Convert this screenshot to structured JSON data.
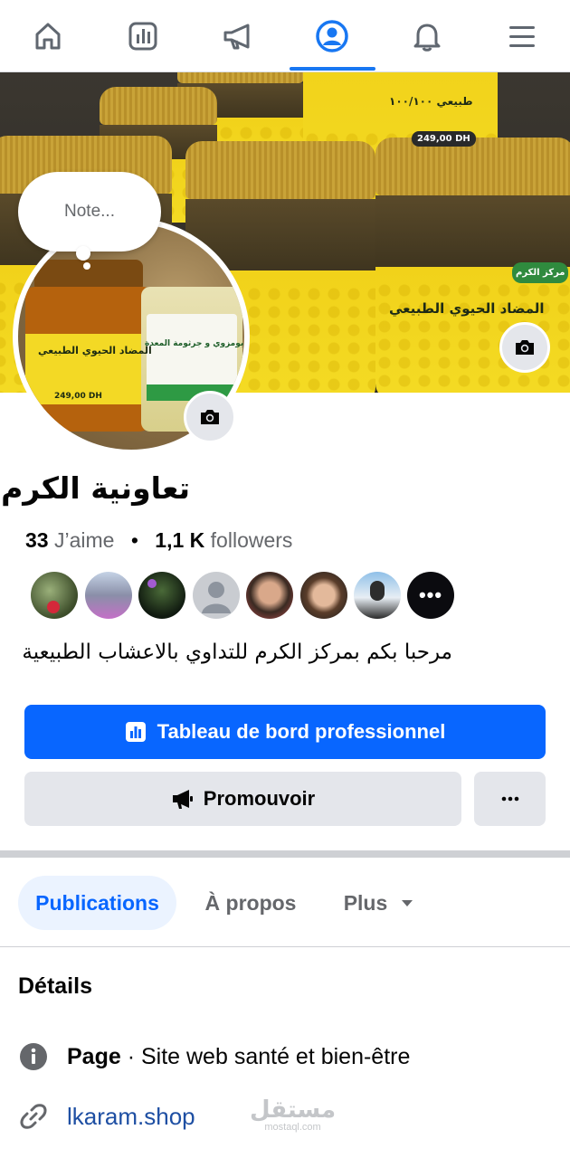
{
  "nav": {
    "items": [
      {
        "name": "home",
        "icon": "home-icon"
      },
      {
        "name": "dashboard",
        "icon": "bar-chart-icon"
      },
      {
        "name": "ads",
        "icon": "megaphone-icon"
      },
      {
        "name": "profile",
        "icon": "profile-icon",
        "active": true
      },
      {
        "name": "notifications",
        "icon": "bell-icon"
      },
      {
        "name": "menu",
        "icon": "hamburger-menu-icon"
      }
    ],
    "accent": "#1877f2"
  },
  "note": {
    "placeholder": "Note..."
  },
  "page": {
    "name": "تعاونية الكرم",
    "likes_count": "33",
    "likes_label": "J’aime",
    "followers_count": "1,1 K",
    "followers_label": "followers",
    "more_followers_label": "•••",
    "bio": "مرحبا بكم بمركز الكرم للتداوي بالاعشاب الطبيعية"
  },
  "cover_labels": {
    "product_name": "المضاد الحيوي الطبيعي",
    "brand": "مركز الكرم",
    "price": "249,00 DH",
    "natural": "طبيعي ١٠٠/١٠٠",
    "product2": "تركيبة بومزوي و جرثومة المعدة"
  },
  "actions": {
    "dashboard_label": "Tableau de bord professionnel",
    "promote_label": "Promouvoir",
    "primary_color": "#0866ff"
  },
  "tabs": [
    {
      "label": "Publications",
      "active": true
    },
    {
      "label": "À propos",
      "active": false
    },
    {
      "label": "Plus",
      "active": false
    }
  ],
  "details": {
    "title": "Détails",
    "category_prefix": "Page",
    "category_text": " · Site web santé et bien-être",
    "website": "lkaram.shop"
  },
  "watermark": {
    "arabic": "مستقل",
    "latin": "mostaql.com"
  }
}
